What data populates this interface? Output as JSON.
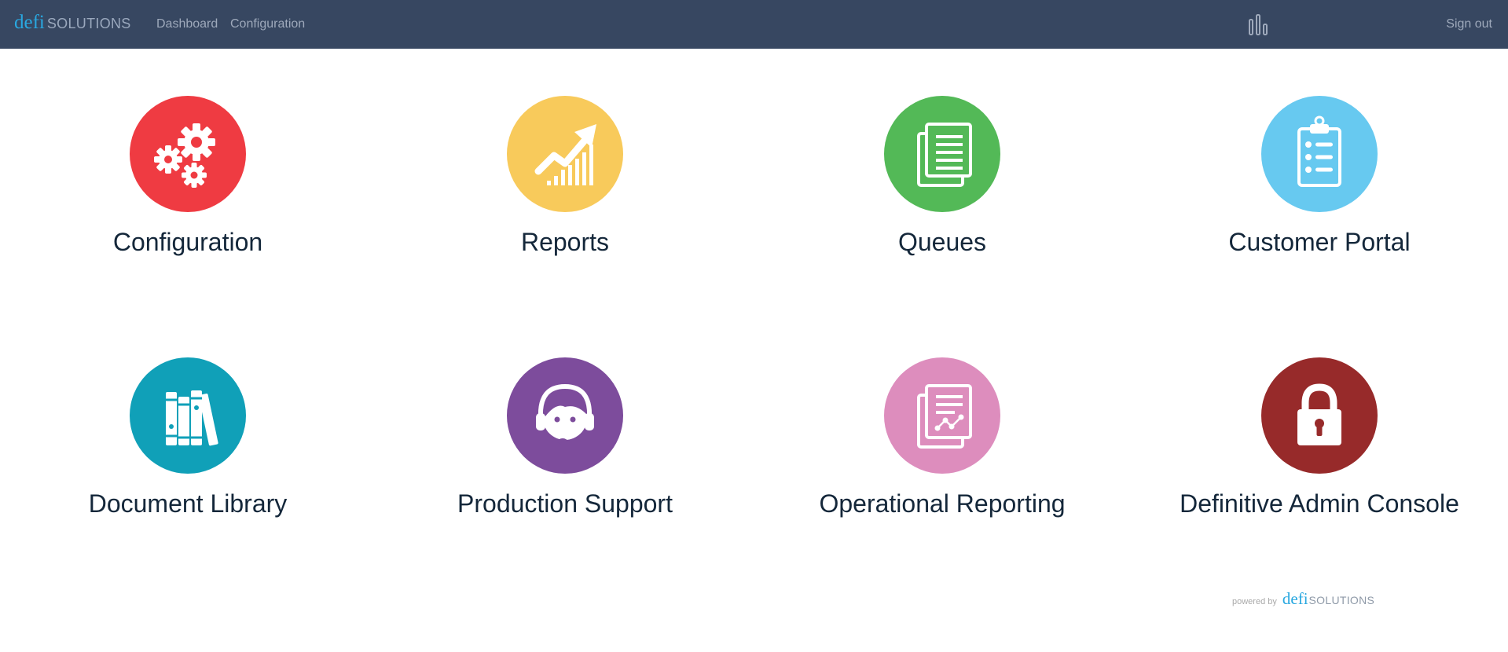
{
  "brand": {
    "defi": "defi",
    "solutions": "SOLUTIONS"
  },
  "nav": {
    "dashboard": "Dashboard",
    "configuration": "Configuration",
    "signout": "Sign out",
    "stats_icon": "bar-chart-icon"
  },
  "tiles": [
    {
      "label": "Configuration",
      "color": "#ef3b42",
      "icon": "gears-icon"
    },
    {
      "label": "Reports",
      "color": "#f8ca5b",
      "icon": "trending-chart-icon"
    },
    {
      "label": "Queues",
      "color": "#53b957",
      "icon": "documents-icon"
    },
    {
      "label": "Customer Portal",
      "color": "#67c9f0",
      "icon": "clipboard-icon"
    },
    {
      "label": "Document Library",
      "color": "#10a0b8",
      "icon": "books-icon"
    },
    {
      "label": "Production Support",
      "color": "#7d4c9c",
      "icon": "support-agent-icon"
    },
    {
      "label": "Operational Reporting",
      "color": "#dd8dbd",
      "icon": "report-documents-icon"
    },
    {
      "label": "Definitive Admin Console",
      "color": "#972a2a",
      "icon": "lock-icon"
    }
  ],
  "footer": {
    "powered_by": "powered by",
    "defi": "defi",
    "solutions": "SOLUTIONS"
  }
}
